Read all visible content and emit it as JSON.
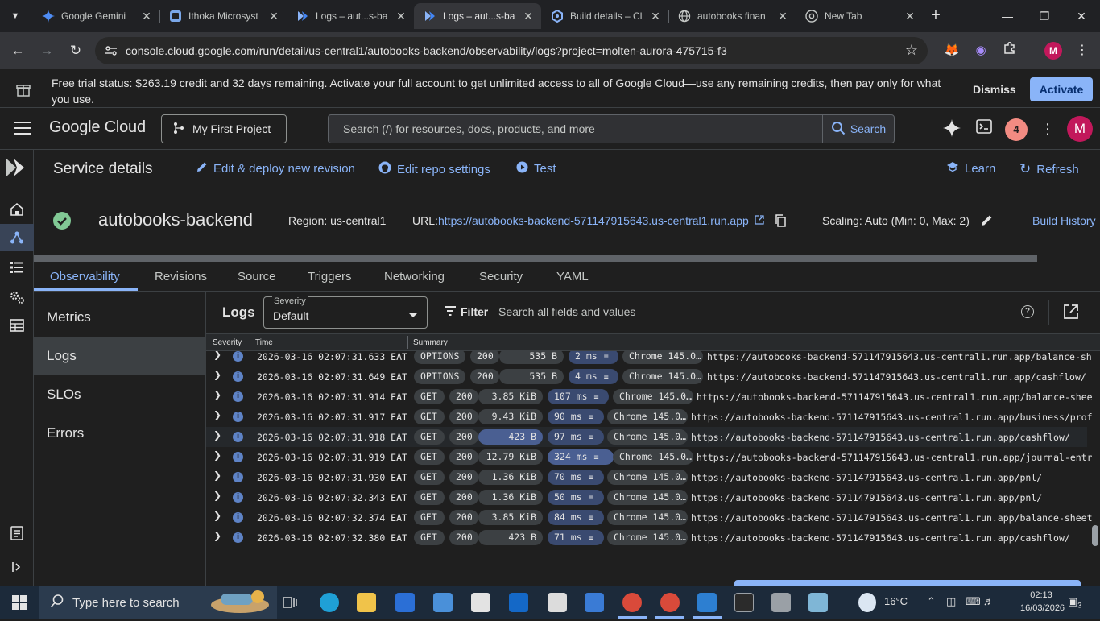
{
  "browser": {
    "tabs": [
      {
        "title": "Google Gemini",
        "icon": "gemini-icon"
      },
      {
        "title": "Ithoka Microsyst",
        "icon": "app-icon"
      },
      {
        "title": "Logs – aut...s-ba",
        "icon": "cloud-run-icon"
      },
      {
        "title": "Logs – aut...s-ba",
        "icon": "cloud-run-icon",
        "active": true
      },
      {
        "title": "Build details – Cl",
        "icon": "cloud-build-icon"
      },
      {
        "title": "autobooks finan",
        "icon": "globe-icon"
      },
      {
        "title": "New Tab",
        "icon": "chrome-icon"
      }
    ],
    "url": "console.cloud.google.com/run/detail/us-central1/autobooks-backend/observability/logs?project=molten-aurora-475715-f3",
    "profile_initial": "M"
  },
  "banner": {
    "text": "Free trial status: $263.19 credit and 32 days remaining. Activate your full account to get unlimited access to all of Google Cloud—use any remaining credits, then pay only for what you use.",
    "dismiss_label": "Dismiss",
    "activate_label": "Activate"
  },
  "header": {
    "logo": "Google Cloud",
    "project": "My First Project",
    "search_placeholder": "Search (/) for resources, docs, products, and more",
    "search_button": "Search",
    "notifications": "4",
    "avatar_initial": "M"
  },
  "service": {
    "page_title": "Service details",
    "actions": {
      "edit_deploy": "Edit & deploy new revision",
      "edit_repo": "Edit repo settings",
      "test": "Test",
      "learn": "Learn",
      "refresh": "Refresh"
    },
    "name": "autobooks-backend",
    "region": "Region: us-central1",
    "url_label": "URL:",
    "url": "https://autobooks-backend-571147915643.us-central1.run.app",
    "scaling": "Scaling: Auto (Min: 0, Max: 2)",
    "build_history": "Build History"
  },
  "tabs": [
    "Observability",
    "Revisions",
    "Source",
    "Triggers",
    "Networking",
    "Security",
    "YAML"
  ],
  "side_menu": [
    "Metrics",
    "Logs",
    "SLOs",
    "Errors"
  ],
  "logs": {
    "title": "Logs",
    "severity_label": "Severity",
    "severity_value": "Default",
    "filter_label": "Filter",
    "filter_placeholder": "Search all fields and values",
    "columns": {
      "severity": "Severity",
      "time": "Time",
      "summary": "Summary"
    },
    "rows": [
      {
        "time": "2026-03-16 02:07:31.633 EAT",
        "method": "OPTIONS",
        "status": "200",
        "size": "535 B",
        "latency": "2 ms",
        "agent": "Chrome 145.0…",
        "url": "https://autobooks-backend-571147915643.us-central1.run.app/balance-sh…"
      },
      {
        "time": "2026-03-16 02:07:31.649 EAT",
        "method": "OPTIONS",
        "status": "200",
        "size": "535 B",
        "latency": "4 ms",
        "agent": "Chrome 145.0…",
        "url": "https://autobooks-backend-571147915643.us-central1.run.app/cashflow/"
      },
      {
        "time": "2026-03-16 02:07:31.914 EAT",
        "method": "GET",
        "status": "200",
        "size": "3.85 KiB",
        "latency": "107 ms",
        "agent": "Chrome 145.0…",
        "url": "https://autobooks-backend-571147915643.us-central1.run.app/balance-shee…"
      },
      {
        "time": "2026-03-16 02:07:31.917 EAT",
        "method": "GET",
        "status": "200",
        "size": "9.43 KiB",
        "latency": "90 ms",
        "agent": "Chrome 145.0…",
        "url": "https://autobooks-backend-571147915643.us-central1.run.app/business/prof…"
      },
      {
        "time": "2026-03-16 02:07:31.918 EAT",
        "method": "GET",
        "status": "200",
        "size": "423 B",
        "latency": "97 ms",
        "agent": "Chrome 145.0…",
        "url": "https://autobooks-backend-571147915643.us-central1.run.app/cashflow/"
      },
      {
        "time": "2026-03-16 02:07:31.919 EAT",
        "method": "GET",
        "status": "200",
        "size": "12.79 KiB",
        "latency": "324 ms",
        "agent": "Chrome 145.0…",
        "url": "https://autobooks-backend-571147915643.us-central1.run.app/journal-entr…"
      },
      {
        "time": "2026-03-16 02:07:31.930 EAT",
        "method": "GET",
        "status": "200",
        "size": "1.36 KiB",
        "latency": "70 ms",
        "agent": "Chrome 145.0…",
        "url": "https://autobooks-backend-571147915643.us-central1.run.app/pnl/"
      },
      {
        "time": "2026-03-16 02:07:32.343 EAT",
        "method": "GET",
        "status": "200",
        "size": "1.36 KiB",
        "latency": "50 ms",
        "agent": "Chrome 145.0…",
        "url": "https://autobooks-backend-571147915643.us-central1.run.app/pnl/"
      },
      {
        "time": "2026-03-16 02:07:32.374 EAT",
        "method": "GET",
        "status": "200",
        "size": "3.85 KiB",
        "latency": "84 ms",
        "agent": "Chrome 145.0…",
        "url": "https://autobooks-backend-571147915643.us-central1.run.app/balance-sheet/"
      },
      {
        "time": "2026-03-16 02:07:32.380 EAT",
        "method": "GET",
        "status": "200",
        "size": "423 B",
        "latency": "71 ms",
        "agent": "Chrome 145.0…",
        "url": "https://autobooks-backend-571147915643.us-central1.run.app/cashflow/"
      }
    ]
  },
  "taskbar": {
    "search_placeholder": "Type here to search",
    "weather": "16°C",
    "time": "02:13",
    "date": "16/03/2026",
    "notification_count": "3"
  },
  "colors": {
    "accent": "#8ab4f8",
    "success": "#81c995",
    "brand_avatar": "#c2185b"
  }
}
